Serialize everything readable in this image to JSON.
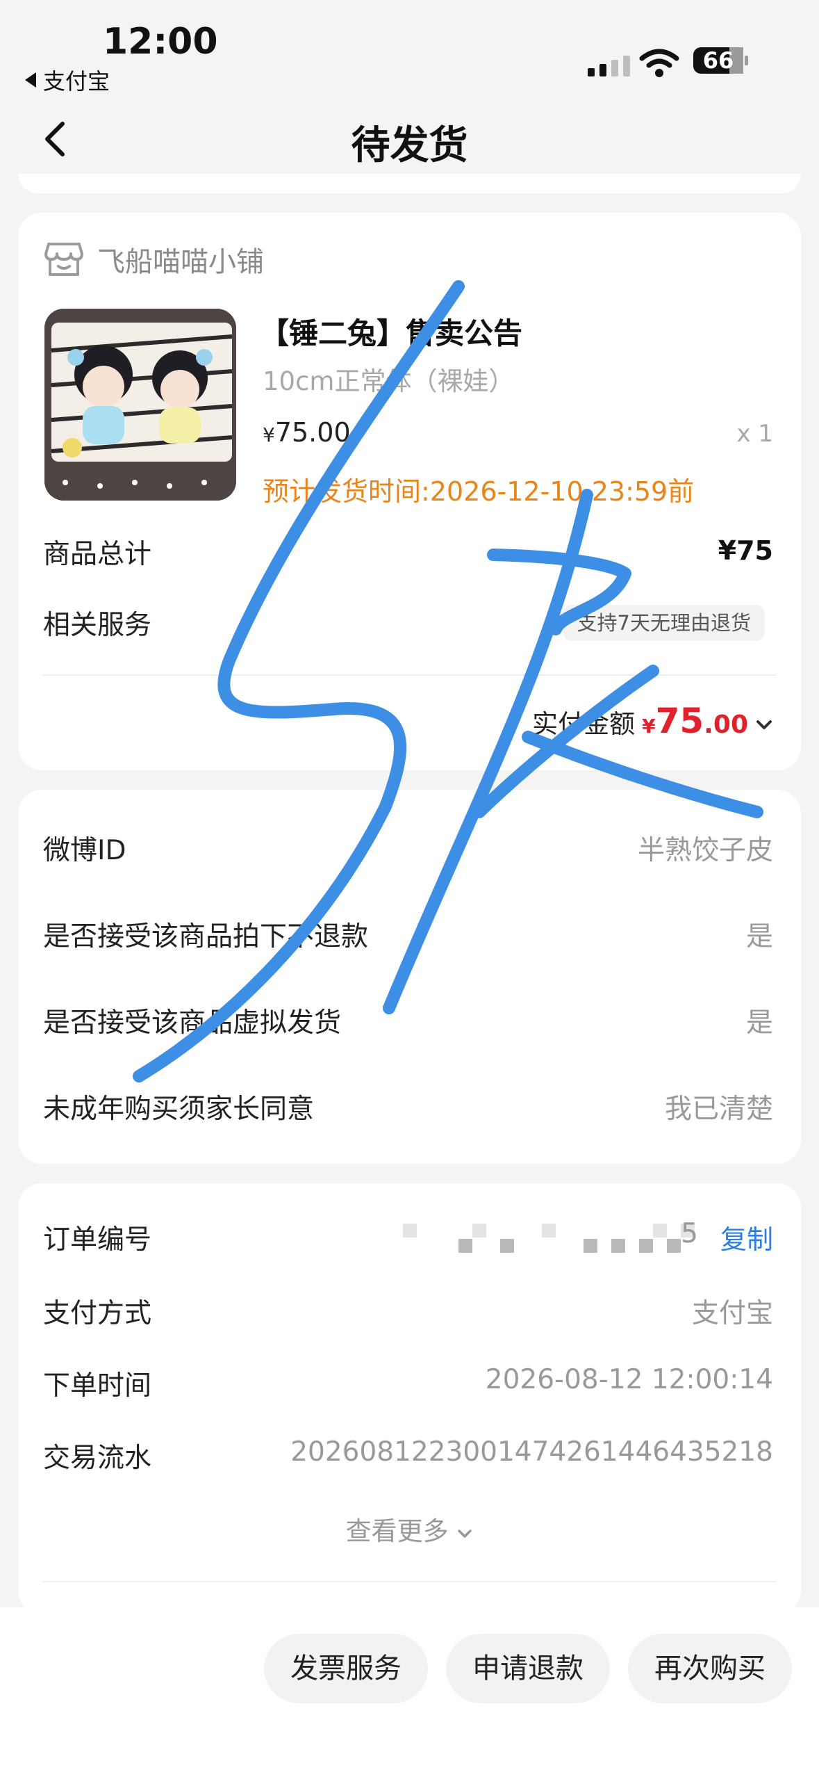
{
  "status_bar": {
    "time": "12:00",
    "back_app": "支付宝",
    "battery": "66"
  },
  "nav": {
    "title": "待发货"
  },
  "shop": {
    "name": "飞船喵喵小铺"
  },
  "product": {
    "title": "【锤二兔】售卖公告",
    "spec": "10cm正常体（裸娃）",
    "price_symbol": "¥",
    "price": "75.00",
    "quantity": "x 1",
    "ship_time": "预计发货时间:2026-12-10 23:59前"
  },
  "summary": {
    "total_label": "商品总计",
    "total_value": "¥75",
    "service_label": "相关服务",
    "service_tag": "支持7天无理由退货",
    "paid_label": "实付金额",
    "paid_symbol": "¥",
    "paid_int": "75",
    "paid_dec": ".00"
  },
  "questions": [
    {
      "label": "微博ID",
      "value": "半熟饺子皮"
    },
    {
      "label": "是否接受该商品拍下不退款",
      "value": "是"
    },
    {
      "label": "是否接受该商品虚拟发货",
      "value": "是"
    },
    {
      "label": "未成年购买须家长同意",
      "value": "我已清楚"
    }
  ],
  "order_info": {
    "order_no_label": "订单编号",
    "order_no_tail": "5",
    "copy_label": "复制",
    "pay_method_label": "支付方式",
    "pay_method_value": "支付宝",
    "order_time_label": "下单时间",
    "order_time_value": "2026-08-12 12:00:14",
    "trade_no_label": "交易流水",
    "trade_no_value": "2026081223001474261446435218",
    "view_more": "查看更多"
  },
  "actions": {
    "invoice": "发票服务",
    "refund": "申请退款",
    "rebuy": "再次购买"
  },
  "colors": {
    "accent_red": "#e0202a",
    "ship_orange": "#e8841a",
    "link_blue": "#2e7de0",
    "scribble_blue": "#3d8fe6"
  }
}
